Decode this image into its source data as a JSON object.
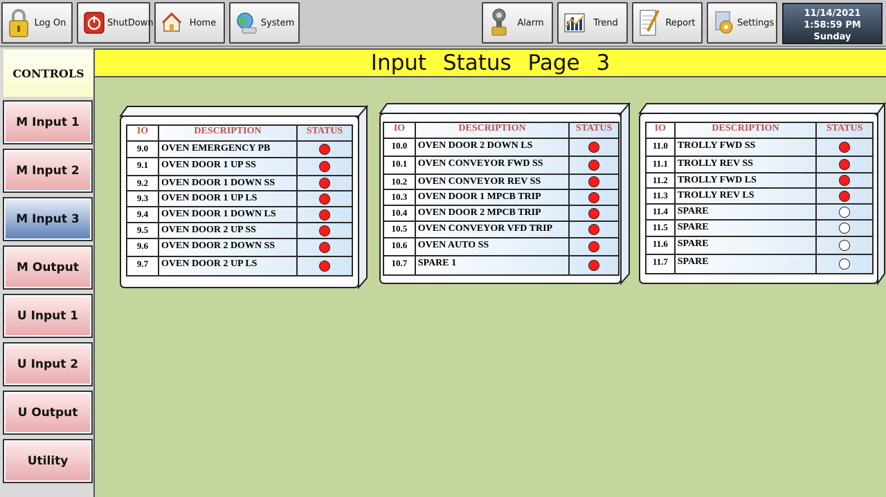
{
  "toolbar": {
    "logon_label": "Log On",
    "shutdown_label": "ShutDown",
    "home_label": "Home",
    "system_label": "System",
    "alarm_label": "Alarm",
    "trend_label": "Trend",
    "report_label": "Report",
    "settings_label": "Settings"
  },
  "clock": {
    "date": "11/14/2021",
    "time": "1:58:59 PM",
    "day": "Sunday"
  },
  "sidebar": {
    "title": "CONTROLS",
    "items": [
      {
        "label": "M Input 1",
        "active": false
      },
      {
        "label": "M Input 2",
        "active": false
      },
      {
        "label": "M Input 3",
        "active": true
      },
      {
        "label": "M Output",
        "active": false
      },
      {
        "label": "U Input 1",
        "active": false
      },
      {
        "label": "U Input 2",
        "active": false
      },
      {
        "label": "U Output",
        "active": false
      },
      {
        "label": "Utility",
        "active": false
      }
    ]
  },
  "header": {
    "title": "Input Status Page 3"
  },
  "columns": {
    "io": "IO",
    "description": "DESCRIPTION",
    "status": "STATUS"
  },
  "colors": {
    "status_on": "#ff1a1a",
    "status_off": "#ffffff",
    "banner": "#ffff3c",
    "background": "#c4d69e"
  },
  "panels": [
    {
      "rows": [
        {
          "io": "9.0",
          "desc": "OVEN EMERGENCY PB",
          "on": true
        },
        {
          "io": "9.1",
          "desc": "OVEN DOOR 1 UP SS",
          "on": true
        },
        {
          "io": "9.2",
          "desc": "OVEN DOOR 1 DOWN SS",
          "on": true
        },
        {
          "io": "9.3",
          "desc": "OVEN DOOR 1 UP LS",
          "on": true
        },
        {
          "io": "9.4",
          "desc": "OVEN DOOR 1 DOWN LS",
          "on": true
        },
        {
          "io": "9.5",
          "desc": "OVEN DOOR 2 UP SS",
          "on": true
        },
        {
          "io": "9.6",
          "desc": "OVEN DOOR 2 DOWN SS",
          "on": true
        },
        {
          "io": "9.7",
          "desc": "OVEN DOOR 2 UP LS",
          "on": true
        }
      ]
    },
    {
      "rows": [
        {
          "io": "10.0",
          "desc": "OVEN DOOR 2 DOWN LS",
          "on": true
        },
        {
          "io": "10.1",
          "desc": "OVEN CONVEYOR FWD SS",
          "on": true
        },
        {
          "io": "10.2",
          "desc": "OVEN CONVEYOR REV SS",
          "on": true
        },
        {
          "io": "10.3",
          "desc": "OVEN DOOR 1 MPCB TRIP",
          "on": true
        },
        {
          "io": "10.4",
          "desc": "OVEN DOOR 2 MPCB TRIP",
          "on": true
        },
        {
          "io": "10.5",
          "desc": "OVEN CONVEYOR VFD TRIP",
          "on": true
        },
        {
          "io": "10.6",
          "desc": "OVEN AUTO SS",
          "on": true
        },
        {
          "io": "10.7",
          "desc": "SPARE 1",
          "on": true
        }
      ]
    },
    {
      "rows": [
        {
          "io": "11.0",
          "desc": "TROLLY FWD SS",
          "on": true
        },
        {
          "io": "11.1",
          "desc": "TROLLY REV SS",
          "on": true
        },
        {
          "io": "11.2",
          "desc": "TROLLY FWD LS",
          "on": true
        },
        {
          "io": "11.3",
          "desc": "TROLLY REV LS",
          "on": true
        },
        {
          "io": "11.4",
          "desc": "SPARE",
          "on": false
        },
        {
          "io": "11.5",
          "desc": "SPARE",
          "on": false
        },
        {
          "io": "11.6",
          "desc": "SPARE",
          "on": false
        },
        {
          "io": "11.7",
          "desc": "SPARE",
          "on": false
        }
      ]
    }
  ]
}
